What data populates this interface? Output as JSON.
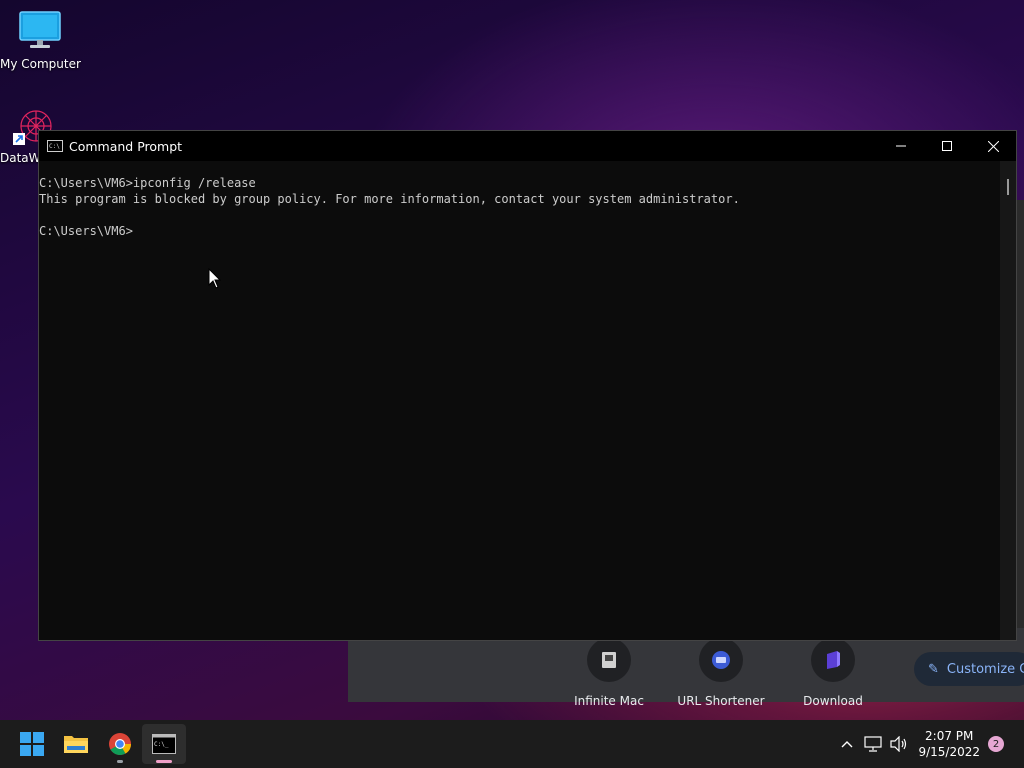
{
  "desktop": {
    "icons": [
      {
        "label": "My Computer",
        "icon": "monitor-icon"
      },
      {
        "label": "DataW",
        "icon": "datawrapper-shortcut-icon"
      }
    ]
  },
  "background_window": {
    "shortcuts": [
      {
        "label": "Infinite Mac"
      },
      {
        "label": "URL Shortener"
      },
      {
        "label": "Download"
      }
    ],
    "customize_label": "Customize C"
  },
  "cmd": {
    "title": "Command Prompt",
    "lines": [
      "C:\\Users\\VM6>ipconfig /release",
      "This program is blocked by group policy. For more information, contact your system administrator.",
      "",
      "C:\\Users\\VM6>"
    ],
    "controls": {
      "minimize": "—",
      "maximize": "☐",
      "close": "✕"
    }
  },
  "taskbar": {
    "apps": [
      {
        "name": "start",
        "icon": "windows-icon"
      },
      {
        "name": "file-explorer",
        "icon": "folder-icon"
      },
      {
        "name": "chrome",
        "icon": "chrome-icon"
      },
      {
        "name": "command-prompt",
        "icon": "terminal-icon",
        "active": true
      }
    ],
    "clock": {
      "time": "2:07 PM",
      "date": "9/15/2022"
    },
    "notification_count": "2"
  }
}
